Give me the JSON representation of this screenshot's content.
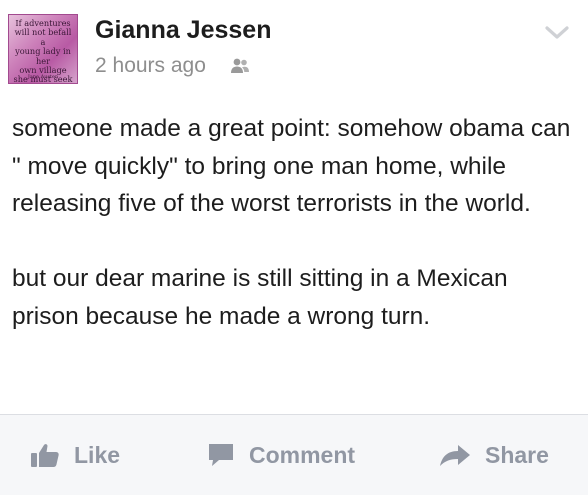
{
  "post": {
    "author": "Gianna Jessen",
    "timestamp": "2 hours ago",
    "audience_icon": "friends-icon",
    "menu_icon": "chevron-down-icon",
    "avatar_text": "If adventures\nwill not befall a\nyoung lady in her\nown village\nshe must seek\nthem abroad",
    "avatar_author": "Jane Austen",
    "paragraphs": [
      "someone made a great point: somehow obama can \" move quickly\" to bring one man home, while releasing five of the worst terrorists in the world.",
      "but our dear marine is still sitting in a Mexican prison because he made a wrong turn."
    ]
  },
  "actions": {
    "like": "Like",
    "comment": "Comment",
    "share": "Share"
  },
  "colors": {
    "action_text": "#9197a3",
    "action_bar_bg": "#f6f7f9",
    "timestamp": "#8e8e8e",
    "avatar": "#cf86bd"
  }
}
